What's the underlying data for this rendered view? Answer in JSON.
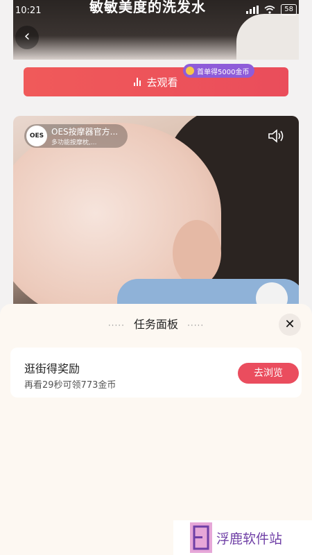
{
  "status_bar": {
    "time": "10:21",
    "battery": "58"
  },
  "feed": {
    "top_card": {
      "headline": "敏敏美度的洗发水"
    },
    "watch_button": {
      "label": "去观看"
    },
    "coin_badge": {
      "label": "首单得5000金币"
    },
    "video_ad": {
      "logo_text": "OES",
      "advertiser_name": "OES按摩器官方...",
      "advertiser_sub": "多功能按摩枕,..."
    }
  },
  "task_panel": {
    "title": "任务面板",
    "task": {
      "title": "逛街得奖励",
      "subtitle": "再看29秒可领773金币",
      "button": "去浏览"
    }
  },
  "watermark": {
    "text": "浮鹿软件站"
  },
  "colors": {
    "accent": "#ea4d5e",
    "badge": "#8e5cd9",
    "sheet_bg": "#fdf8f2"
  },
  "icons": [
    "back-arrow-icon",
    "bar-chart-icon",
    "coin-icon",
    "sound-icon",
    "close-icon"
  ]
}
